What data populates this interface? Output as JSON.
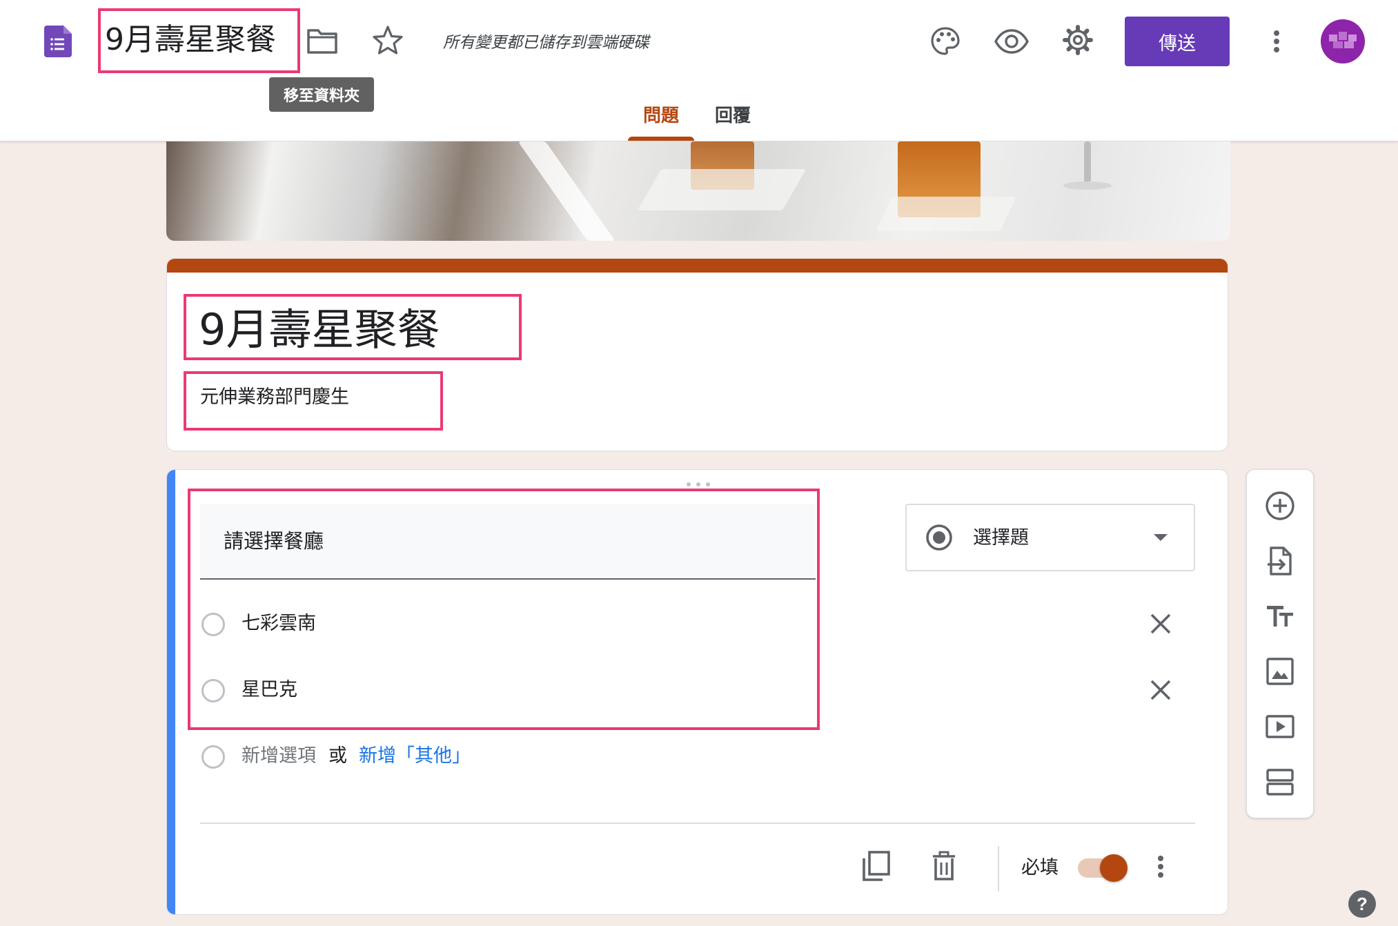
{
  "header": {
    "doc_title": "9月壽星聚餐",
    "save_status": "所有變更都已儲存到雲端硬碟",
    "move_to_folder_tooltip": "移至資料夾",
    "send_label": "傳送",
    "icons": [
      "forms-doc-icon",
      "folder-icon",
      "star-icon",
      "palette-icon",
      "eye-icon",
      "gear-icon",
      "more-vert-icon",
      "avatar"
    ],
    "tabs": [
      {
        "label": "問題",
        "active": true
      },
      {
        "label": "回覆",
        "active": false
      }
    ]
  },
  "form": {
    "title": "9月壽星聚餐",
    "description": "元伸業務部門慶生"
  },
  "question": {
    "text": "請選擇餐廳",
    "type": "選擇題",
    "options": [
      {
        "label": "七彩雲南"
      },
      {
        "label": "星巴克"
      }
    ],
    "add_option": "新增選項",
    "or_label": "或",
    "add_other": "新增「其他」",
    "required_label": "必填",
    "required": true
  },
  "side_toolbar": {
    "icons": [
      "add-question-icon",
      "import-questions-icon",
      "add-title-icon",
      "add-image-icon",
      "add-video-icon",
      "add-section-icon"
    ]
  },
  "colors": {
    "accent": "#b4470f",
    "send_button": "#673ab7",
    "highlight_box": "#ea3a72",
    "question_bar": "#4285f4",
    "page_background": "#f5ebe7",
    "link": "#1a73e8"
  }
}
